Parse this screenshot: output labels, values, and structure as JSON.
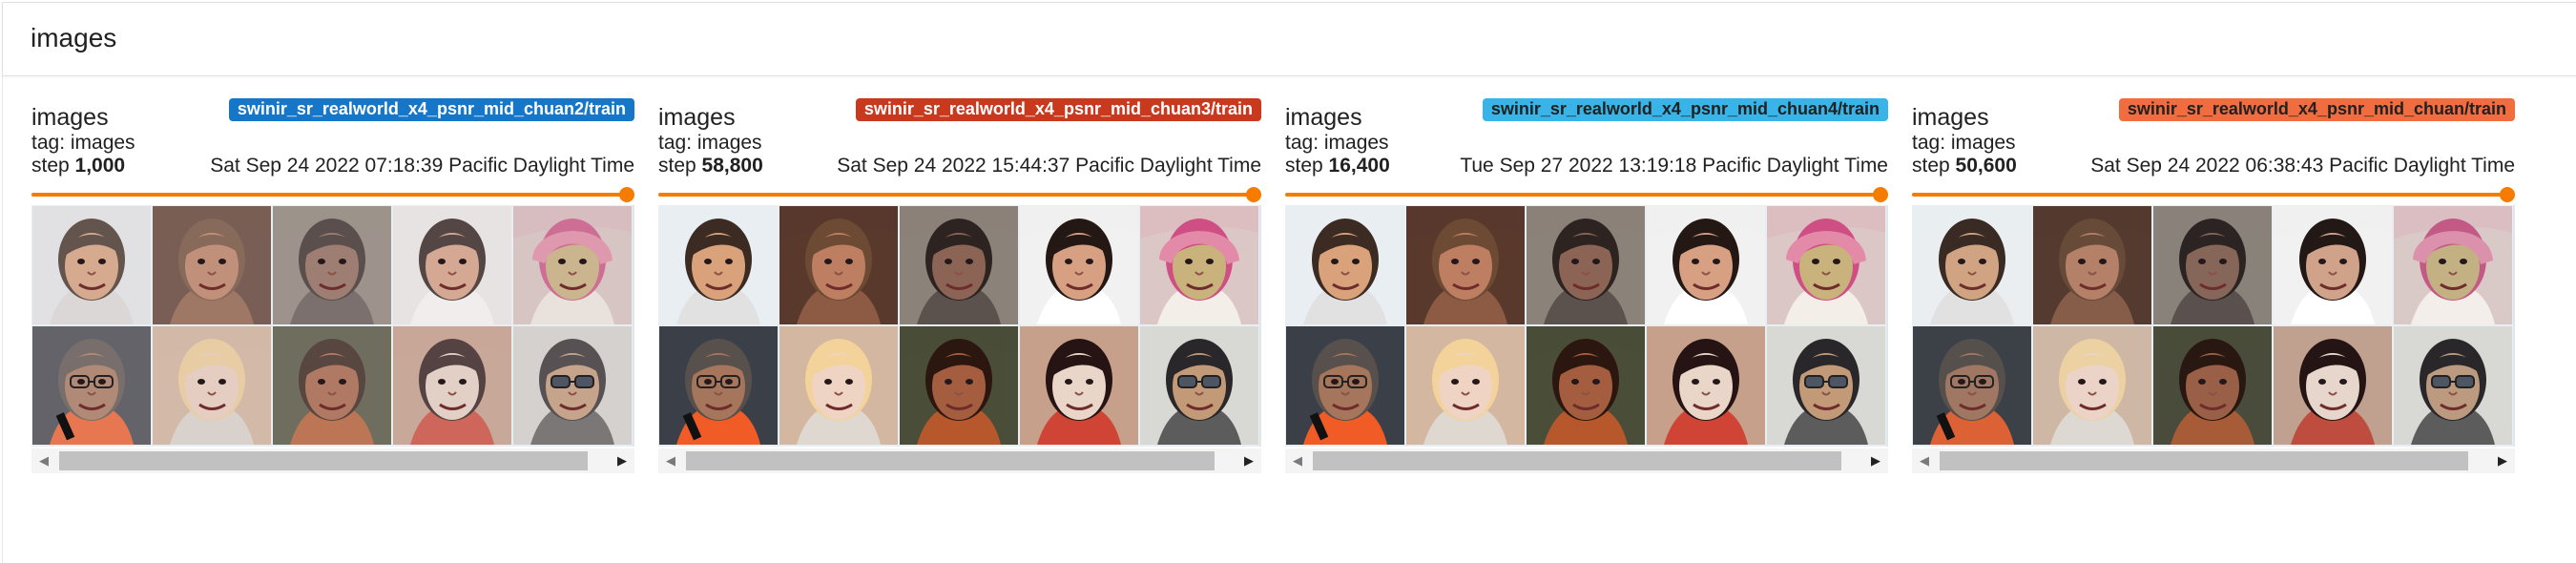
{
  "section": {
    "title": "images"
  },
  "cards": [
    {
      "title": "images",
      "run": "swinir_sr_realworld_x4_psnr_mid_chuan2/train",
      "run_color": "#1676c7",
      "run_text_color": "#ffffff",
      "tag": "tag: images",
      "step_label": "step",
      "step": "1,000",
      "timestamp": "Sat Sep 24 2022 07:18:39 Pacific Daylight Time",
      "slider_position": 1.0,
      "tone": "faded"
    },
    {
      "title": "images",
      "run": "swinir_sr_realworld_x4_psnr_mid_chuan3/train",
      "run_color": "#c9391d",
      "run_text_color": "#ffffff",
      "tag": "tag: images",
      "step_label": "step",
      "step": "58,800",
      "timestamp": "Sat Sep 24 2022 15:44:37 Pacific Daylight Time",
      "slider_position": 1.0,
      "tone": "vivid"
    },
    {
      "title": "images",
      "run": "swinir_sr_realworld_x4_psnr_mid_chuan4/train",
      "run_color": "#38b4e8",
      "run_text_color": "#212121",
      "tag": "tag: images",
      "step_label": "step",
      "step": "16,400",
      "timestamp": "Tue Sep 27 2022 13:19:18 Pacific Daylight Time",
      "slider_position": 1.0,
      "tone": "vivid"
    },
    {
      "title": "images",
      "run": "swinir_sr_realworld_x4_psnr_mid_chuan/train",
      "run_color": "#f16d3f",
      "run_text_color": "#212121",
      "tag": "tag: images",
      "step_label": "step",
      "step": "50,600",
      "timestamp": "Sat Sep 24 2022 06:38:43 Pacific Daylight Time",
      "slider_position": 1.0,
      "tone": "muted"
    }
  ],
  "image_tiles": [
    {
      "name": "baby-portrait",
      "background": "#e9eef2",
      "skin": "#d9a27b",
      "hair": "#3b2b22",
      "clothing": "#e1e1e1"
    },
    {
      "name": "smiling-woman-portrait",
      "background": "#58392c",
      "skin": "#bd7e61",
      "hair": "#6d4a33",
      "clothing": "#8d5b43"
    },
    {
      "name": "woman-portrait",
      "background": "#8b8279",
      "skin": "#8c6455",
      "hair": "#2d2421",
      "clothing": "#5b514d"
    },
    {
      "name": "toddler-portrait",
      "background": "#f1f1f1",
      "skin": "#d8a083",
      "hair": "#241815",
      "clothing": "#ffffff"
    },
    {
      "name": "headscarf-woman-portrait",
      "background": "#dbc8c6",
      "skin": "#c9b27b",
      "hair": "#cf4f85",
      "clothing": "#f4eee8"
    },
    {
      "name": "man-with-glasses-portrait",
      "background": "#3b4048",
      "skin": "#a6765c",
      "hair": "#57504c",
      "clothing": "#f15b26"
    },
    {
      "name": "blonde-woman-portrait",
      "background": "#d4b7a0",
      "skin": "#efd3c3",
      "hair": "#f3d39a",
      "clothing": "#ded8d1"
    },
    {
      "name": "girl-portrait",
      "background": "#4a4d38",
      "skin": "#a45e3f",
      "hair": "#2b170f",
      "clothing": "#b6582c"
    },
    {
      "name": "bob-haircut-woman-portrait",
      "background": "#c6a08a",
      "skin": "#ead5c9",
      "hair": "#261313",
      "clothing": "#d04435"
    },
    {
      "name": "man-with-sunglasses-portrait",
      "background": "#d8d9d5",
      "skin": "#c39a78",
      "hair": "#29272a",
      "clothing": "#5d5c5c"
    }
  ]
}
